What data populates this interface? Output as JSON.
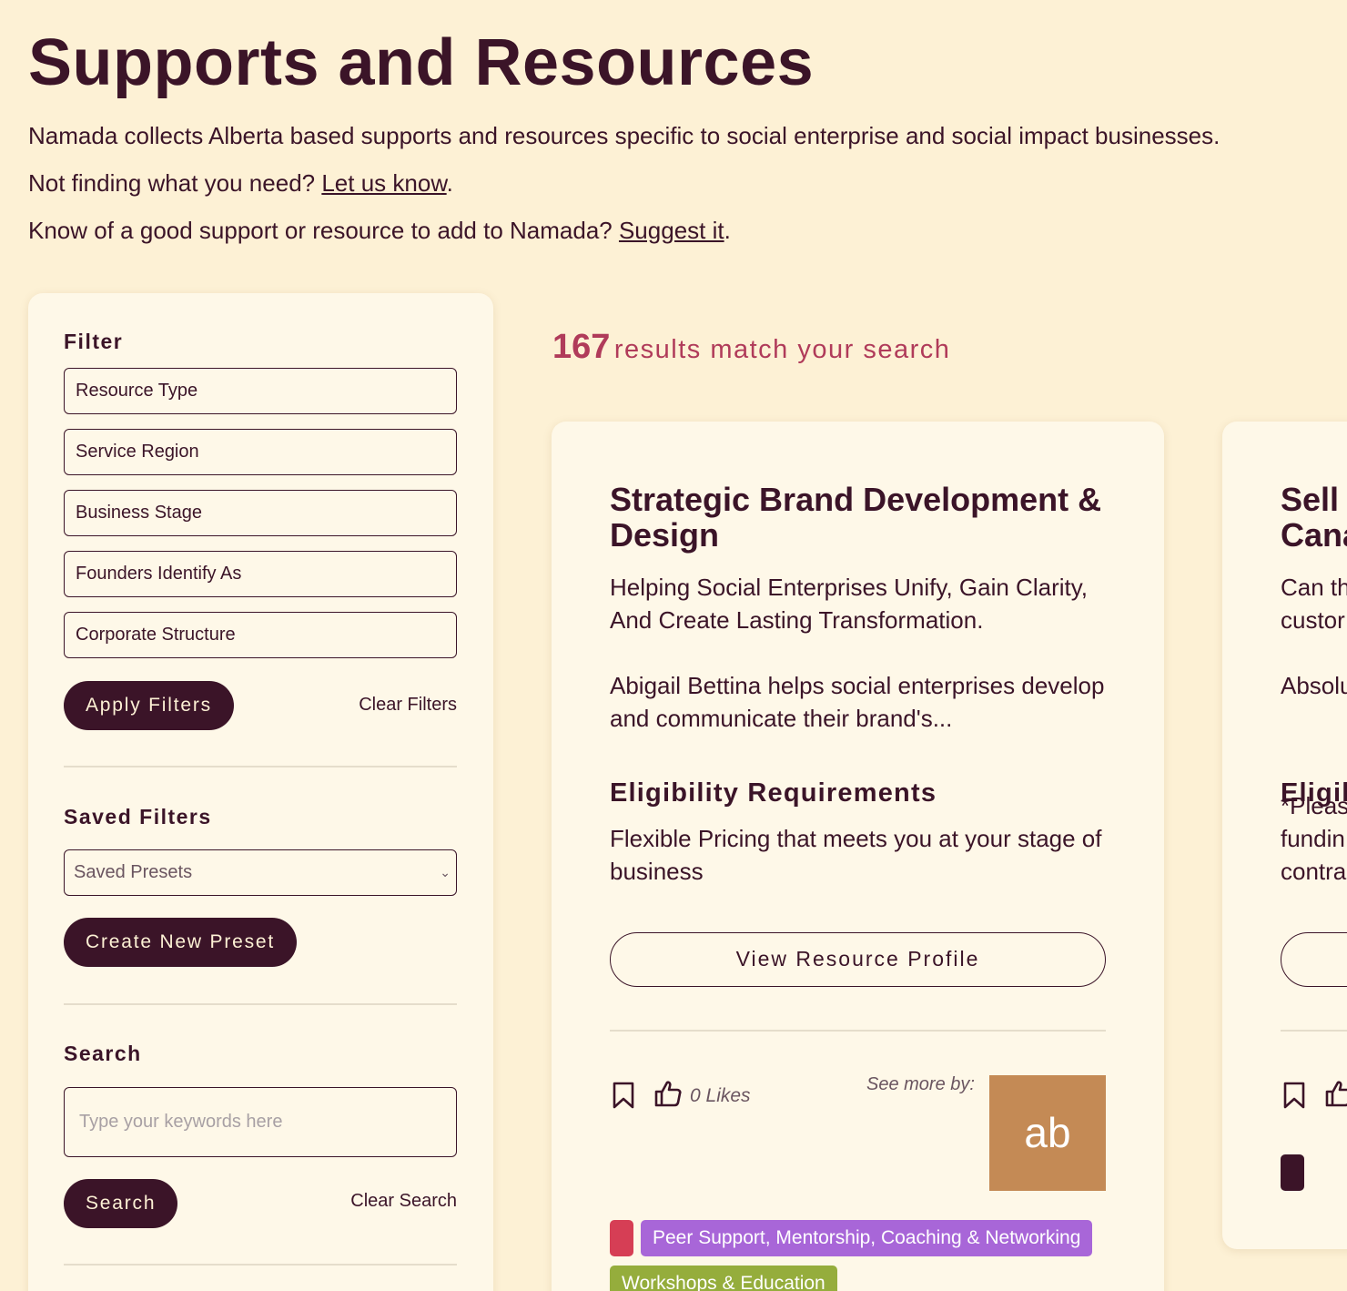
{
  "header": {
    "title": "Supports and Resources",
    "intro_line": "Namada collects Alberta based supports and resources specific to social enterprise and social impact businesses.",
    "not_finding_prefix": "Not finding what you need? ",
    "let_us_know_link": "Let us know",
    "period_1": ".",
    "suggest_prefix": "Know of a good support or resource to add to Namada? ",
    "suggest_link": "Suggest it",
    "period_2": "."
  },
  "sidebar": {
    "filter_heading": "Filter",
    "filters": [
      "Resource Type",
      "Service Region",
      "Business Stage",
      "Founders Identify As",
      "Corporate Structure"
    ],
    "apply_filters": "Apply Filters",
    "clear_filters": "Clear Filters",
    "saved_filters_heading": "Saved Filters",
    "saved_presets_value": "Saved Presets",
    "create_new_preset": "Create New Preset",
    "search_heading": "Search",
    "search_placeholder": "Type your keywords here",
    "search_button": "Search",
    "clear_search": "Clear Search"
  },
  "results": {
    "count": "167",
    "count_text": "results match your search"
  },
  "cards": [
    {
      "title": "Strategic Brand Development & Design",
      "subtitle": "Helping Social Enterprises Unify, Gain Clarity, And Create Lasting Transformation.",
      "description": "Abigail Bettina helps social enterprises develop and communicate their brand's...",
      "eligibility_heading": "Eligibility Requirements",
      "eligibility_text": "Flexible Pricing that meets you at your stage of business",
      "view_button": "View Resource Profile",
      "likes": "0 Likes",
      "see_more": "See more by:",
      "logo_text": "ab",
      "tags": [
        {
          "label": "",
          "color": "#d63e55"
        },
        {
          "label": "Peer Support, Mentorship, Coaching & Networking",
          "color": "#a866d8"
        },
        {
          "label": "Workshops & Education",
          "color": "#95ad3c"
        }
      ]
    },
    {
      "title": "Sell t Cana",
      "subtitle": "Can th custor",
      "description": "Absolu",
      "eligibility_heading": "Eligib",
      "eligibility_text": "*Pleas fundin contra",
      "tags": [
        {
          "label": "",
          "color": "#3b1428"
        }
      ]
    }
  ],
  "icons": {
    "bookmark": "bookmark-icon",
    "like": "thumbs-up-icon",
    "chevron": "chevron-down-icon"
  },
  "colors": {
    "background": "#fdf1d5",
    "panel": "#fef8e8",
    "primary": "#3b1428",
    "accent": "#b03b5a"
  }
}
